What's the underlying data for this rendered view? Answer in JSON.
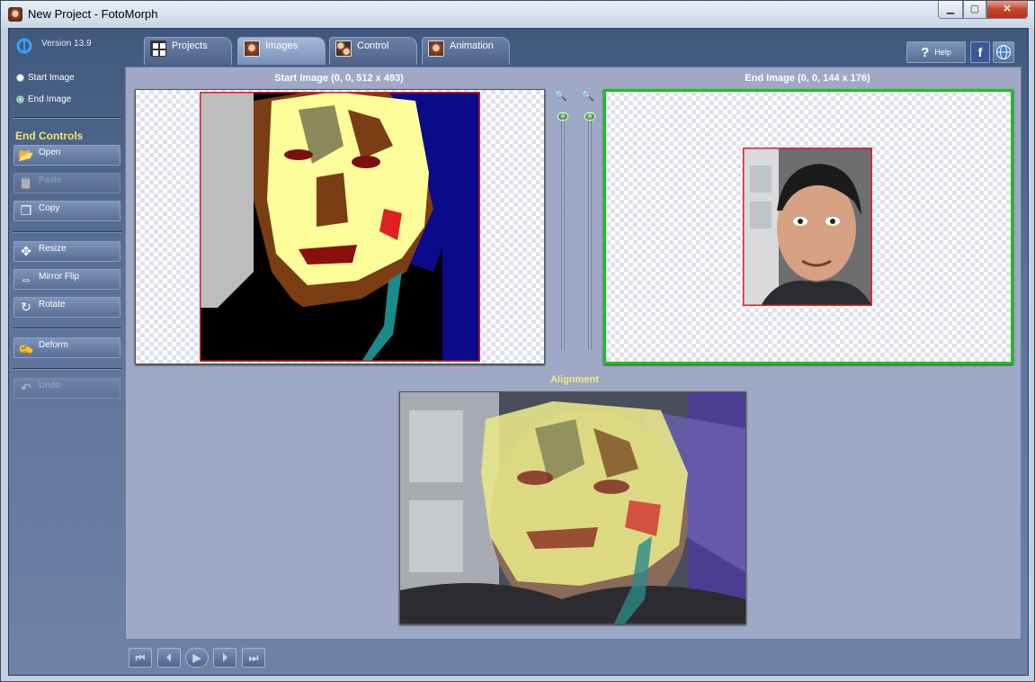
{
  "window": {
    "title": "New Project - FotoMorph",
    "minimize": "▁",
    "maximize": "▢",
    "close": "✕"
  },
  "sidebar": {
    "version": "Version 13.9",
    "radio_start": "Start Image",
    "radio_end": "End Image",
    "section_title": "End Controls",
    "buttons": [
      {
        "label": "Open",
        "icon": "folder-open-icon",
        "enabled": true
      },
      {
        "label": "Paste",
        "icon": "paste-icon",
        "enabled": false
      },
      {
        "label": "Copy",
        "icon": "copy-icon",
        "enabled": true
      },
      {
        "label": "Resize",
        "icon": "resize-icon",
        "enabled": true
      },
      {
        "label": "Mirror Flip",
        "icon": "mirror-flip-icon",
        "enabled": true
      },
      {
        "label": "Rotate",
        "icon": "rotate-icon",
        "enabled": true
      },
      {
        "label": "Deform",
        "icon": "deform-icon",
        "enabled": true
      },
      {
        "label": "Undo",
        "icon": "undo-icon",
        "enabled": false
      }
    ]
  },
  "tabs": [
    {
      "label": "Projects",
      "active": false
    },
    {
      "label": "Images",
      "active": true
    },
    {
      "label": "Control",
      "active": false
    },
    {
      "label": "Animation",
      "active": false
    }
  ],
  "top_right": {
    "help": "Help",
    "facebook": "f",
    "web": "globe-icon"
  },
  "main": {
    "start_caption": "Start Image (0, 0, 512 x 493)",
    "end_caption": "End Image (0, 0, 144 x 176)",
    "alignment_caption": "Alignment"
  },
  "colors": {
    "accent_yellow": "#f2e877",
    "end_border": "#1fbf1f",
    "start_border": "#e02020"
  },
  "playback": {
    "first": "⏮",
    "prev": "⏴",
    "play": "▶",
    "next": "⏵",
    "last": "⏭"
  }
}
